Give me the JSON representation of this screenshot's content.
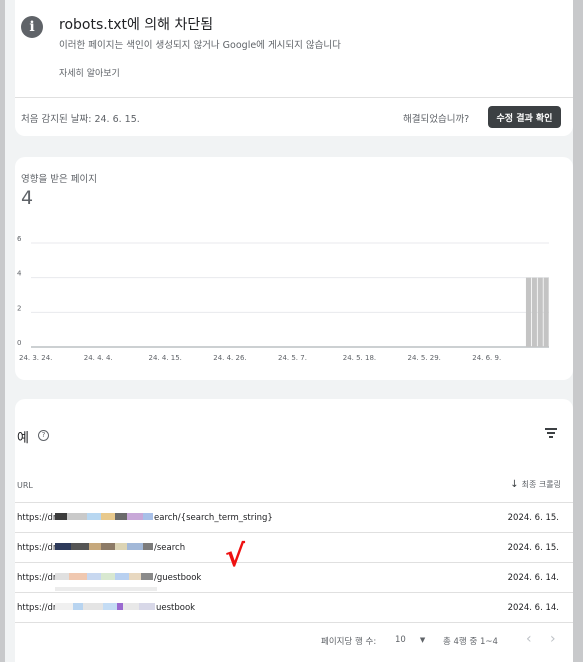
{
  "issue": {
    "icon": "info-icon",
    "title": "robots.txt에 의해 차단됨",
    "subtitle": "이러한 페이지는 색인이 생성되지 않거나 Google에 게시되지 않습니다",
    "learn_more": "자세히 알아보기",
    "first_detected": "처음 감지된 날짜: 24. 6. 15.",
    "resolved_question": "해결되었습니까?",
    "validate_button": "수정 결과 확인"
  },
  "affected": {
    "label": "영향을 받은 페이지",
    "count": "4"
  },
  "chart_data": {
    "type": "bar",
    "y_ticks": [
      "6",
      "4",
      "2",
      "0"
    ],
    "ylim": [
      0,
      6
    ],
    "x_tick_labels": [
      "24. 3. 24.",
      "24. 4. 4.",
      "24. 4. 15.",
      "24. 4. 26.",
      "24. 5. 7.",
      "24. 5. 18.",
      "24. 5. 29.",
      "24. 6. 9."
    ],
    "values": [
      0,
      0,
      0,
      0,
      0,
      0,
      0,
      0,
      0,
      0,
      0,
      0,
      0,
      0,
      0,
      0,
      0,
      0,
      0,
      0,
      0,
      0,
      0,
      0,
      0,
      0,
      0,
      0,
      0,
      0,
      0,
      0,
      0,
      0,
      0,
      0,
      0,
      0,
      0,
      0,
      0,
      0,
      0,
      0,
      0,
      0,
      0,
      0,
      0,
      0,
      0,
      0,
      0,
      0,
      0,
      0,
      0,
      0,
      0,
      0,
      0,
      0,
      0,
      0,
      0,
      0,
      0,
      0,
      0,
      0,
      0,
      0,
      0,
      0,
      0,
      0,
      0,
      0,
      0,
      0,
      0,
      0,
      0,
      0,
      4,
      4,
      4,
      4
    ],
    "bar_color": "#c4c4c4",
    "grid": true
  },
  "examples": {
    "title": "예",
    "help_icon": "help-icon",
    "filter_icon": "filter-icon",
    "col_url": "URL",
    "col_last_crawled": "최종 크롤링",
    "sort_icon": "arrow-down-icon",
    "rows": [
      {
        "url_prefix": "https://dr",
        "url_suffix": "earch/{search_term_string}",
        "date": "2024. 6. 15."
      },
      {
        "url_prefix": "https://dr",
        "url_suffix": "/search",
        "date": "2024. 6. 15."
      },
      {
        "url_prefix": "https://dr",
        "url_suffix": "/guestbook",
        "date": "2024. 6. 14."
      },
      {
        "url_prefix": "https://dr",
        "url_suffix": "uestbook",
        "date": "2024. 6. 14."
      }
    ],
    "check_mark": "√"
  },
  "pagination": {
    "rows_per_page_label": "페이지당 행 수:",
    "rows_per_page": "10",
    "range": "총 4행 중 1~4",
    "prev_icon": "chevron-left-icon",
    "next_icon": "chevron-right-icon"
  }
}
